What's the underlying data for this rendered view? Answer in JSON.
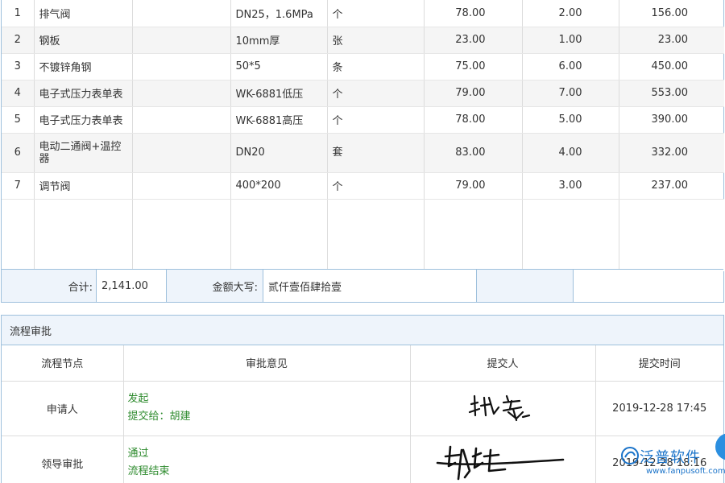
{
  "items": [
    {
      "no": "1",
      "name": "排气阀",
      "extra": "",
      "spec": "DN25，1.6MPa",
      "unit": "个",
      "price": "78.00",
      "qty": "2.00",
      "amount": "156.00"
    },
    {
      "no": "2",
      "name": "钢板",
      "extra": "",
      "spec": "10mm厚",
      "unit": "张",
      "price": "23.00",
      "qty": "1.00",
      "amount": "23.00"
    },
    {
      "no": "3",
      "name": "不镀锌角钢",
      "extra": "",
      "spec": "50*5",
      "unit": "条",
      "price": "75.00",
      "qty": "6.00",
      "amount": "450.00"
    },
    {
      "no": "4",
      "name": "电子式压力表单表",
      "extra": "",
      "spec": "WK-6881低压",
      "unit": "个",
      "price": "79.00",
      "qty": "7.00",
      "amount": "553.00"
    },
    {
      "no": "5",
      "name": "电子式压力表单表",
      "extra": "",
      "spec": "WK-6881高压",
      "unit": "个",
      "price": "78.00",
      "qty": "5.00",
      "amount": "390.00"
    },
    {
      "no": "6",
      "name": "电动二通阀+温控器",
      "extra": "",
      "spec": "DN20",
      "unit": "套",
      "price": "83.00",
      "qty": "4.00",
      "amount": "332.00"
    },
    {
      "no": "7",
      "name": "调节阀",
      "extra": "",
      "spec": "400*200",
      "unit": "个",
      "price": "79.00",
      "qty": "3.00",
      "amount": "237.00"
    }
  ],
  "totals": {
    "total_label": "合计:",
    "total_value": "2,141.00",
    "amount_words_label": "金额大写:",
    "amount_words_value": "贰仟壹佰肆拾壹"
  },
  "flow": {
    "title": "流程审批",
    "headers": {
      "node": "流程节点",
      "opinion": "审批意见",
      "submitter": "提交人",
      "time": "提交时间"
    },
    "rows": [
      {
        "node": "申请人",
        "opinion_line1": "发起",
        "opinion_line2": "提交给：胡建",
        "time": "2019-12-28 17:45",
        "signature": "张鑫"
      },
      {
        "node": "领导审批",
        "opinion_line1": "通过",
        "opinion_line2": "流程结束",
        "time": "2019-12-28 18:16",
        "signature": "胡建"
      }
    ]
  },
  "watermark": {
    "brand": "泛普软件",
    "url": "www.fanpusoft.com"
  },
  "colors": {
    "border": "#9ec0dc",
    "header_bg": "#eef4fb",
    "opinion_green": "#2e8b2e",
    "watermark_blue": "#1a73c9"
  }
}
